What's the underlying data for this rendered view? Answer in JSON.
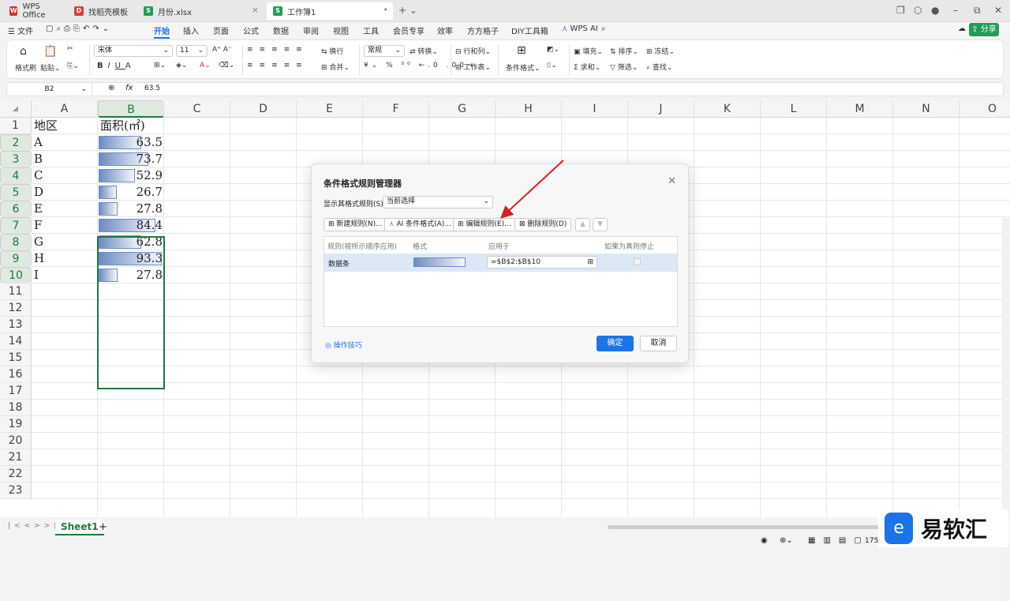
{
  "tabs": [
    {
      "label": "WPS Office",
      "icon": "wps-icon",
      "color": "#d93025"
    },
    {
      "label": "找稻壳模板",
      "icon": "docer-icon",
      "color": "#e0393e"
    },
    {
      "label": "月份.xlsx",
      "icon": "sheet-icon",
      "color": "#1e9e5a"
    },
    {
      "label": "工作簿1",
      "icon": "sheet-icon",
      "color": "#1e9e5a"
    }
  ],
  "menu": {
    "file": "文件",
    "items": [
      "开始",
      "插入",
      "页面",
      "公式",
      "数据",
      "审阅",
      "视图",
      "工具",
      "会员专享",
      "效率",
      "方方格子",
      "DIY工具箱",
      "WPS AI"
    ],
    "active": "开始",
    "share": "分享"
  },
  "ribbon": {
    "format_painter": "格式刷",
    "paste": "粘贴",
    "font": "宋体",
    "size": "11",
    "wrap": "换行",
    "merge": "合并",
    "number_format": "常规",
    "convert": "转换",
    "rows_cols": "行和列",
    "worksheet": "工作表",
    "cond_format": "条件格式",
    "fill": "填充",
    "sort": "排序",
    "freeze": "冻结",
    "sum": "求和",
    "filter": "筛选",
    "find": "查找"
  },
  "formula_bar": {
    "cell_ref": "B2",
    "fx": "fx",
    "value": "63.5"
  },
  "columns": [
    "A",
    "B",
    "C",
    "D",
    "E",
    "F",
    "G",
    "H",
    "I",
    "J",
    "K",
    "L",
    "M",
    "N",
    "O"
  ],
  "rows": [
    "1",
    "2",
    "3",
    "4",
    "5",
    "6",
    "7",
    "8",
    "9",
    "10",
    "11",
    "12",
    "13",
    "14",
    "15",
    "16",
    "17",
    "18",
    "19",
    "20",
    "21",
    "22",
    "23"
  ],
  "table": {
    "header_a": "地区",
    "header_b": "面积(㎡)",
    "regions": [
      "A",
      "B",
      "C",
      "D",
      "E",
      "F",
      "G",
      "H",
      "I"
    ],
    "areas": [
      "63.5",
      "73.7",
      "52.9",
      "26.7",
      "27.8",
      "84.4",
      "62.8",
      "93.3",
      "27.8"
    ],
    "bar_fraction": [
      0.68,
      0.79,
      0.57,
      0.29,
      0.3,
      0.9,
      0.67,
      1.0,
      0.3
    ]
  },
  "sheet_tab": "Sheet1",
  "dialog": {
    "title": "条件格式规则管理器",
    "show_label": "显示其格式规则(S):",
    "show_value": "当前选择",
    "btn_new": "新建规则(N)...",
    "btn_ai": "AI 条件格式(A)...",
    "btn_edit": "编辑规则(E)...",
    "btn_delete": "删除规则(D)",
    "col_rule": "规则(按所示顺序应用)",
    "col_format": "格式",
    "col_applies": "应用于",
    "col_stop": "如果为真则停止",
    "rule_name": "数据条",
    "rule_range": "=$B$2:$B$10",
    "tips": "操作技巧",
    "ok": "确定",
    "cancel": "取消"
  },
  "status": {
    "zoom": "175"
  },
  "watermark": {
    "text": "易软汇"
  }
}
